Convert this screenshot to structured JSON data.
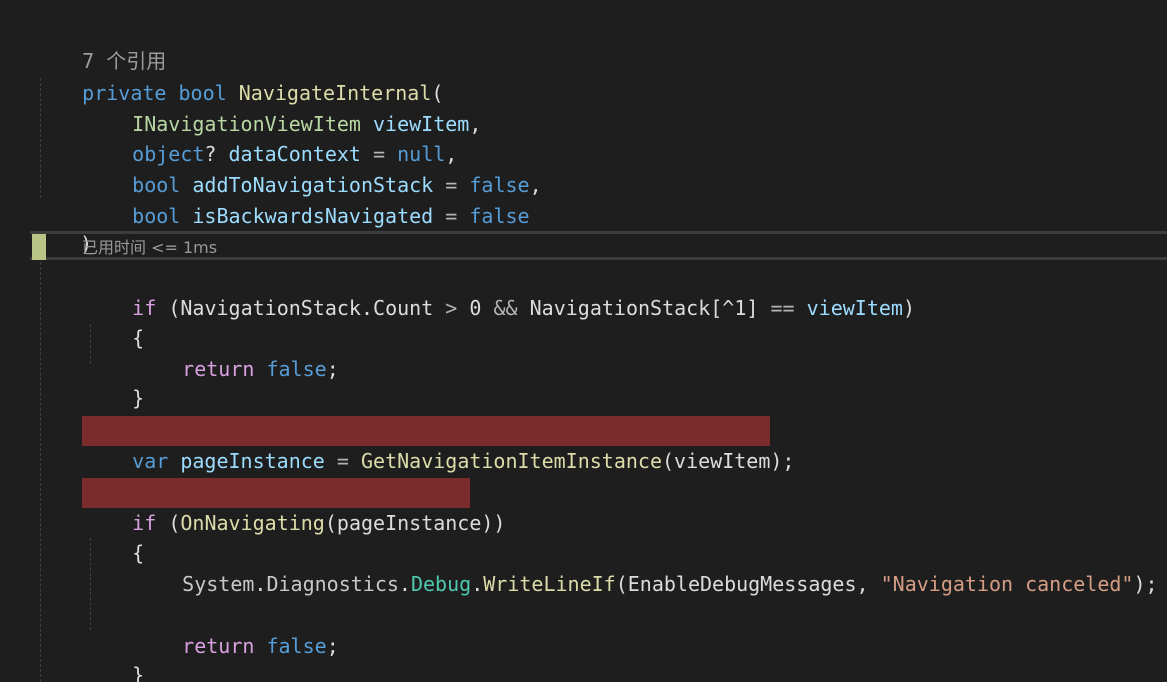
{
  "codelens": {
    "references": "7 个引用",
    "perf_tip": "已用时间 <= 1ms"
  },
  "code": {
    "l2_private": "private",
    "l2_bool": "bool",
    "l2_method": "NavigateInternal",
    "l2_paren": "(",
    "l3_type": "INavigationViewItem",
    "l3_param": "viewItem",
    "l3_comma": ",",
    "l4_object": "object",
    "l4_q": "?",
    "l4_param": "dataContext",
    "l4_eq": "=",
    "l4_null": "null",
    "l4_comma": ",",
    "l5_bool": "bool",
    "l5_param": "addToNavigationStack",
    "l5_eq": "=",
    "l5_false": "false",
    "l5_comma": ",",
    "l6_bool": "bool",
    "l6_param": "isBackwardsNavigated",
    "l6_eq": "=",
    "l6_false": "false",
    "l7_close": ")",
    "l8_open": "{",
    "l9_if": "if",
    "l9_paren": "(",
    "l9_stack": "NavigationStack",
    "l9_dot": ".",
    "l9_count": "Count",
    "l9_gt": ">",
    "l9_zero": "0",
    "l9_and": "&&",
    "l9_stack2": "NavigationStack",
    "l9_idx": "[^1]",
    "l9_eqeq": "==",
    "l9_viewitem": "viewItem",
    "l9_close": ")",
    "l10_open": "{",
    "l11_return": "return",
    "l11_false": "false",
    "l11_semi": ";",
    "l12_close": "}",
    "l14_var": "var",
    "l14_name": "pageInstance",
    "l14_eq": "=",
    "l14_call": "GetNavigationItemInstance",
    "l14_args": "(viewItem);",
    "l16_if": "if",
    "l16_open": "(",
    "l16_call": "OnNavigating",
    "l16_args": "(pageInstance))",
    "l17_open": "{",
    "l18_system": "System",
    "l18_dot1": ".",
    "l18_diag": "Diagnostics",
    "l18_dot2": ".",
    "l18_debug": "Debug",
    "l18_dot3": ".",
    "l18_method": "WriteLineIf",
    "l18_paren": "(",
    "l18_arg": "EnableDebugMessages",
    "l18_comma": ",",
    "l18_str": "\"Navigation canceled\"",
    "l18_end": ");",
    "l20_return": "return",
    "l20_false": "false",
    "l20_semi": ";",
    "l21_close": "}"
  },
  "colors": {
    "background": "#1e1e1e",
    "error_highlight": "#7a2b2b",
    "keyword": "#569cd6",
    "control": "#d8a0df",
    "type": "#b8d7a3",
    "method": "#dcdcaa",
    "string": "#d69d85"
  }
}
